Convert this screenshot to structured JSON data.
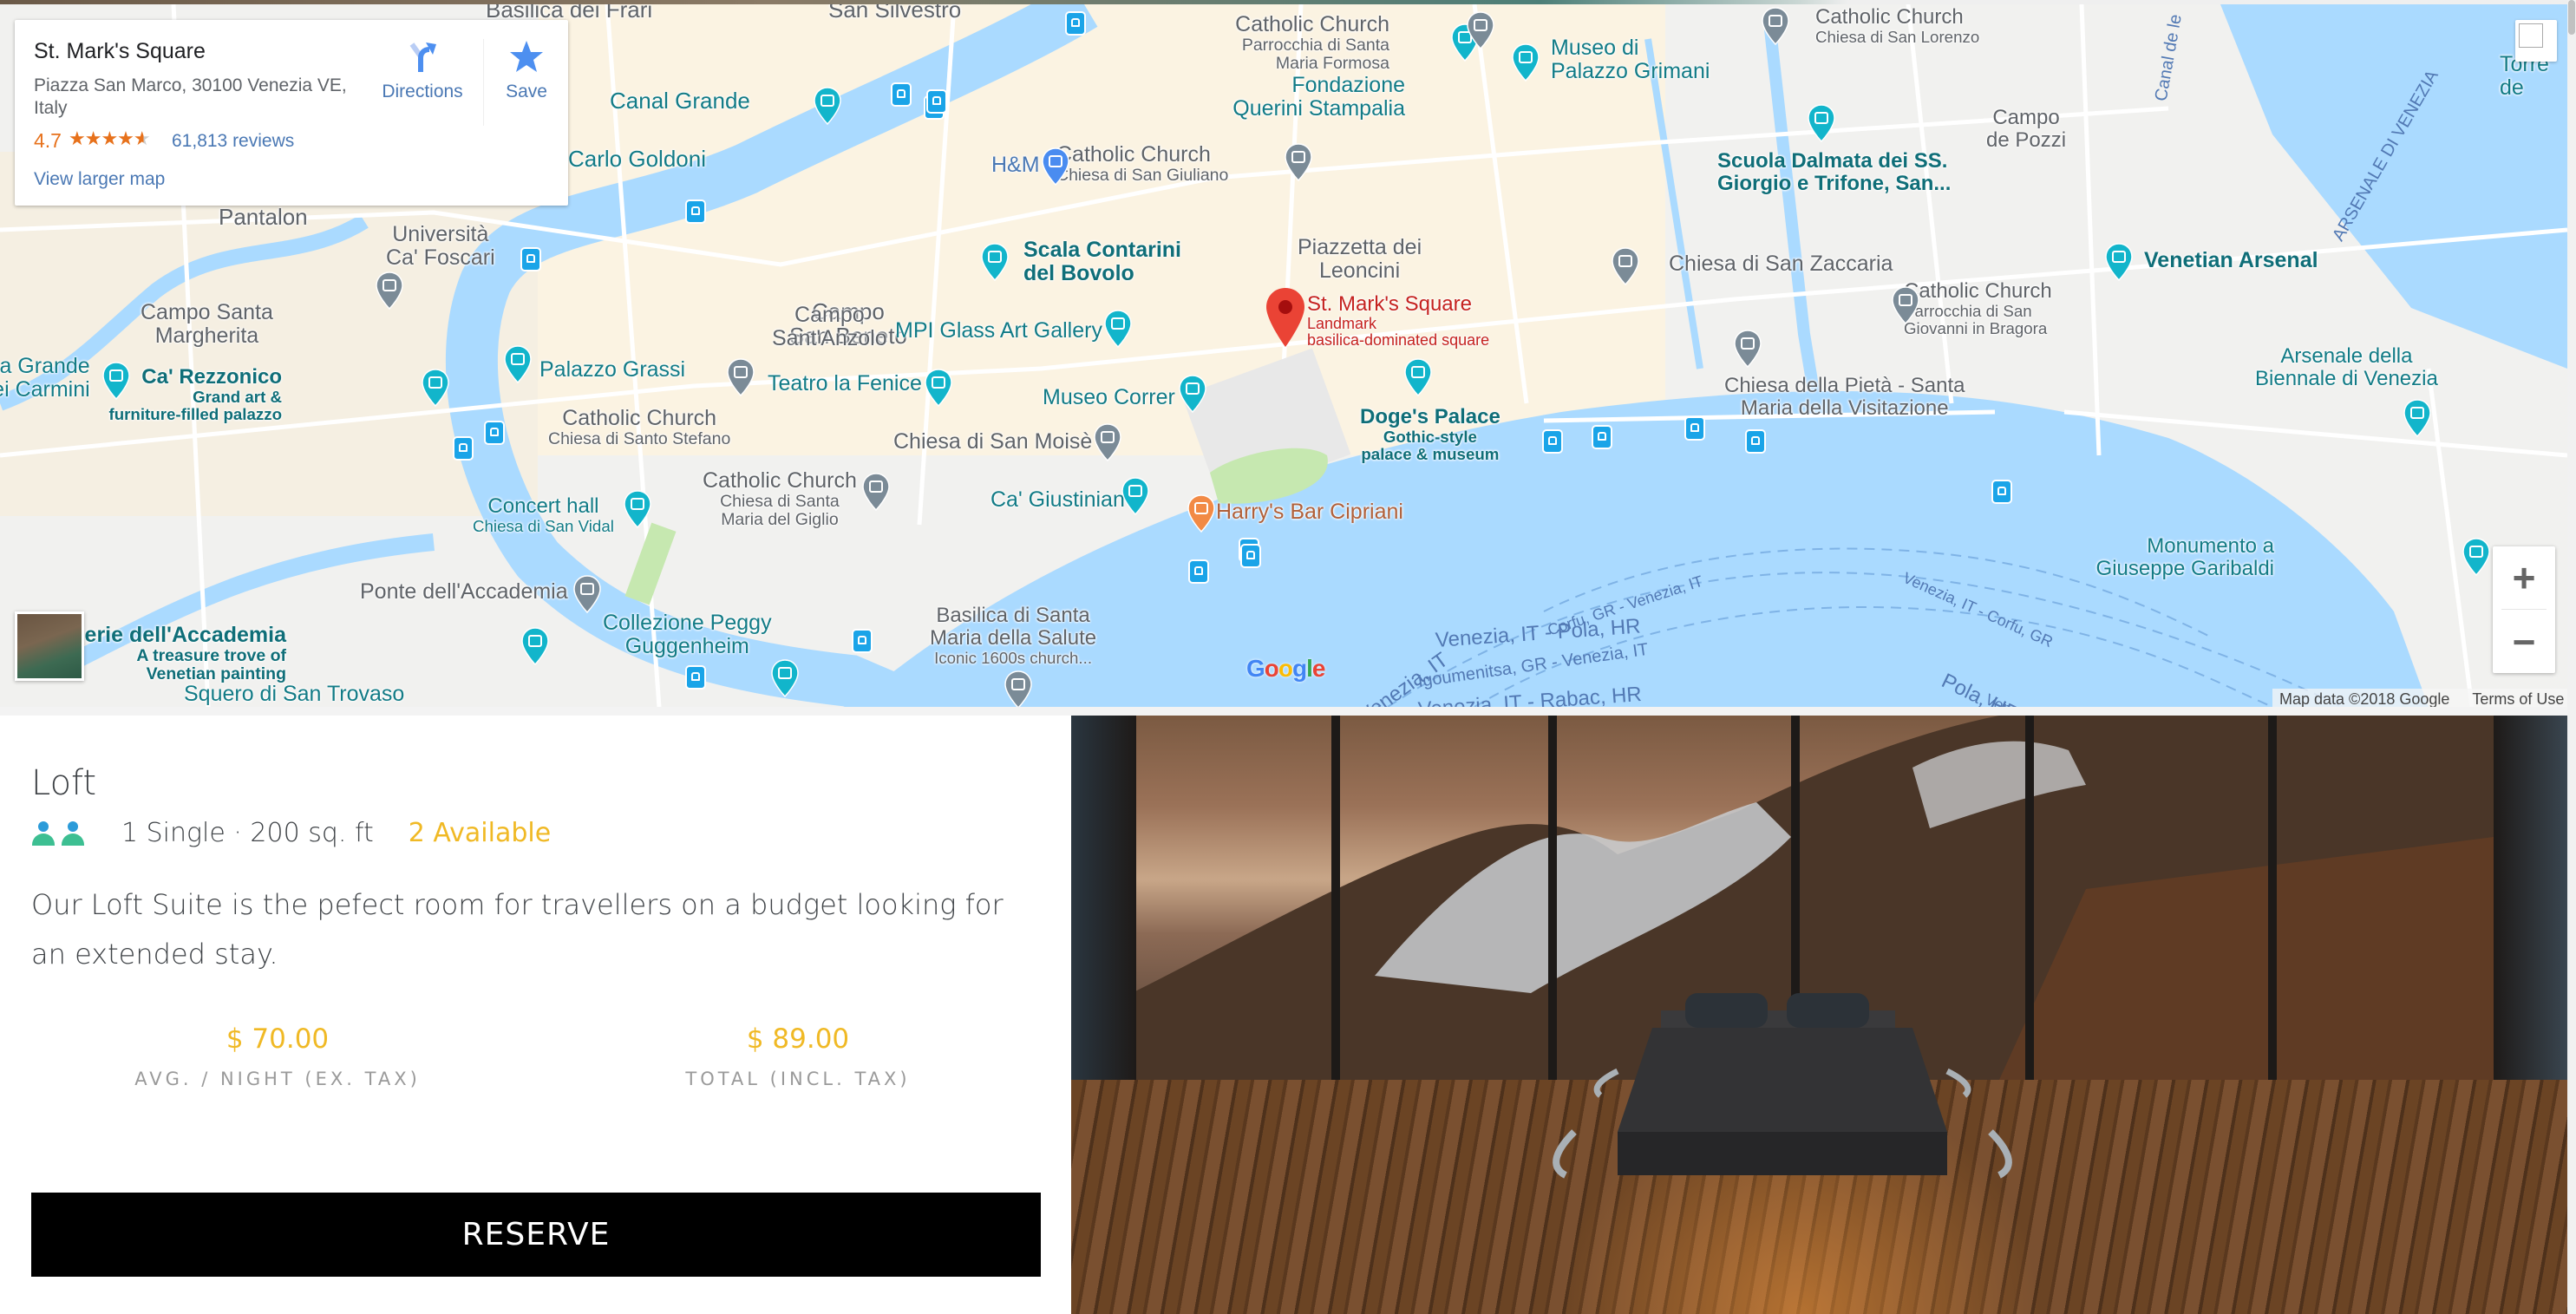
{
  "map": {
    "info_card": {
      "title": "St. Mark's Square",
      "address": "Piazza San Marco, 30100 Venezia VE, Italy",
      "rating": "4.7",
      "rating_stars": 4.7,
      "reviews": "61,813 reviews",
      "view_larger": "View larger map",
      "directions_label": "Directions",
      "save_label": "Save"
    },
    "selected_place": {
      "name": "St. Mark's Square",
      "category": "Landmark",
      "description": "basilica-dominated square"
    },
    "labels": [
      {
        "text": "Basilica dei Frari",
        "style": "gray"
      },
      {
        "text": "San Silvestro",
        "style": "gray"
      },
      {
        "text": "Canal Grande",
        "style": "teal"
      },
      {
        "text": "Carlo Goldoni",
        "style": "teal"
      },
      {
        "text": "Pantalon",
        "style": "gray"
      },
      {
        "text": "Università\nCa' Foscari",
        "style": "gray"
      },
      {
        "text": "Campo Santa\nMargherita",
        "style": "gray"
      },
      {
        "text": "ola Grande\nei Carmini",
        "style": "teal"
      },
      {
        "text": "Campo\nSan Beneto",
        "style": "gray"
      },
      {
        "text": "H&M",
        "style": "blue"
      },
      {
        "text": "Catholic Church",
        "sub": "Chiesa di San Giuliano",
        "style": "gray"
      },
      {
        "text": "Catholic Church",
        "sub": "Parrocchia di Santa\nMaria Formosa",
        "style": "gray"
      },
      {
        "text": "Fondazione\nQuerini Stampalia",
        "style": "teal"
      },
      {
        "text": "Museo di\nPalazzo Grimani",
        "style": "teal"
      },
      {
        "text": "Catholic Church",
        "sub": "Chiesa di San Lorenzo",
        "style": "gray"
      },
      {
        "text": "Scala Contarini\ndel Bovolo",
        "style": "tealb"
      },
      {
        "text": "Piazzetta dei\nLeoncini",
        "style": "gray"
      },
      {
        "text": "Campo\nSant'Anzolo",
        "style": "gray"
      },
      {
        "text": "MPI Glass Art Gallery",
        "style": "teal"
      },
      {
        "text": "Palazzo Grassi",
        "style": "teal"
      },
      {
        "text": "Ca' Rezzonico",
        "sub": "Grand art &\nfurniture-filled palazzo",
        "style": "tealb"
      },
      {
        "text": "Teatro la Fenice",
        "style": "teal"
      },
      {
        "text": "Catholic Church",
        "sub": "Chiesa di Santo Stefano",
        "style": "gray"
      },
      {
        "text": "Museo Correr",
        "style": "teal"
      },
      {
        "text": "Chiesa di San Moisè",
        "style": "gray"
      },
      {
        "text": "Doge's Palace",
        "sub": "Gothic-style\npalace & museum",
        "style": "tealb"
      },
      {
        "text": "Catholic Church",
        "sub": "Chiesa di Santa\nMaria del Giglio",
        "style": "gray"
      },
      {
        "text": "Ca' Giustinian",
        "style": "teal"
      },
      {
        "text": "Harry's Bar Cipriani",
        "style": "orange"
      },
      {
        "text": "Concert hall",
        "sub": "Chiesa di San Vidal",
        "style": "teal"
      },
      {
        "text": "Ponte dell'Accademia",
        "style": "gray"
      },
      {
        "text": "Collezione Peggy\nGuggenheim",
        "style": "teal"
      },
      {
        "text": "Basilica di Santa\nMaria della Salute",
        "sub": "Iconic 1600s church...",
        "style": "gray"
      },
      {
        "text": "Gallerie dell'Accademia",
        "sub": "A treasure trove of\nVenetian painting",
        "style": "tealb"
      },
      {
        "text": "Squero di San Trovaso",
        "style": "teal"
      },
      {
        "text": "Scuola Dalmata dei SS.\nGiorgio e Trifone, San...",
        "style": "tealb"
      },
      {
        "text": "Campo\nde Pozzi",
        "style": "gray"
      },
      {
        "text": "Chiesa di San Zaccaria",
        "style": "gray"
      },
      {
        "text": "Catholic Church",
        "sub": "Parrocchia di San\nGiovanni in Bragora",
        "style": "gray"
      },
      {
        "text": "Chiesa della Pietà - Santa\nMaria della Visitazione",
        "style": "gray"
      },
      {
        "text": "Venetian Arsenal",
        "style": "tealb"
      },
      {
        "text": "Arsenale della\nBiennale di Venezia",
        "style": "teal"
      },
      {
        "text": "Torre de",
        "style": "teal"
      },
      {
        "text": "Monumento a\nGiuseppe Garibaldi",
        "style": "teal"
      }
    ],
    "rotated_labels": [
      "Canal de le",
      "ARSENALE DI VENEZIA",
      "Corfu, GR - Venezia, IT",
      "Venezia, IT - Corfu, GR",
      "Venezia, IT - Pola, HR",
      "Igoumenitsa, GR - Venezia, IT",
      "Venezia, IT - Rabac, HR",
      "Venezia, IT",
      "Pola, HR - Venezi",
      "Venezia, IT - I"
    ],
    "zoom_in_label": "+",
    "zoom_out_label": "−",
    "google_logo": [
      "G",
      "o",
      "o",
      "g",
      "l",
      "e"
    ],
    "attribution": "Map data ©2018 Google",
    "terms": "Terms of Use",
    "colors": {
      "water": "#aadaff",
      "land": "#f1f1ef",
      "urban": "#fbf3e2",
      "park": "#c6e8b0",
      "pin_red": "#ea4335",
      "link_blue": "#4a78b4",
      "rating_orange": "#e7711b"
    }
  },
  "room": {
    "name": "Loft",
    "guest_count": 2,
    "spec": "1 Single · 200 sq. ft",
    "availability": "2 Available",
    "description": "Our Loft Suite is the pefect room for travellers on a budget looking for an extended stay.",
    "prices": [
      {
        "amount": "$ 70.00",
        "caption": "AVG. / NIGHT (EX. TAX)"
      },
      {
        "amount": "$ 89.00",
        "caption": "TOTAL (INCL. TAX)"
      }
    ],
    "reserve_label": "RESERVE",
    "colors": {
      "accent": "#f0b925",
      "text": "#3f4347",
      "caption": "#9a9a9a",
      "button": "#000000"
    }
  },
  "photo": {
    "alt": "Minimal bedroom with floor-to-ceiling windows overlooking snowy mountains at sunset"
  }
}
